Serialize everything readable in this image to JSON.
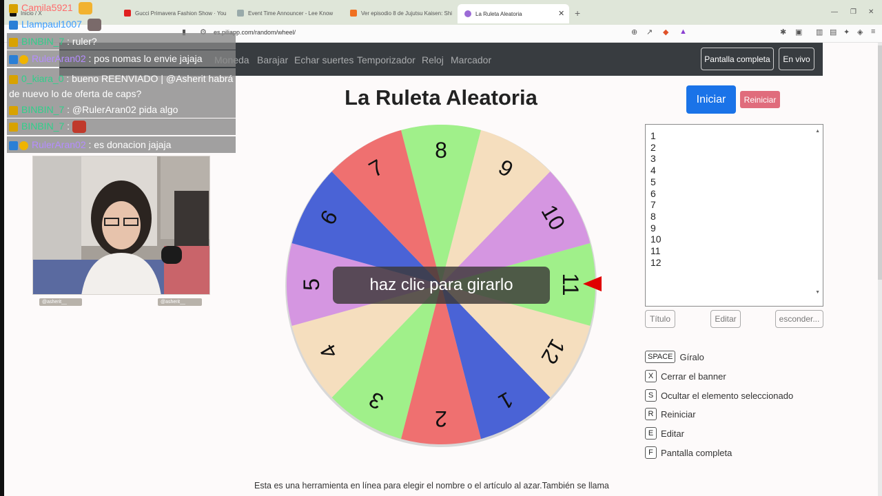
{
  "browser": {
    "tabs": [
      {
        "label": "Inicio / X"
      },
      {
        "label": "Gucci Primavera Fashion Show · You"
      },
      {
        "label": "Event Time Announcer - Lee Know"
      },
      {
        "label": "Ver episodio 8 de Jujutsu Kaisen: Shi"
      },
      {
        "label": "La Ruleta Aleatoria"
      }
    ],
    "url": "es.piliapp.com/random/wheel/"
  },
  "nav": {
    "items": [
      "Moneda",
      "Barajar",
      "Echar suertes",
      "Temporizador",
      "Reloj",
      "Marcador"
    ],
    "fullscreen": "Pantalla completa",
    "live": "En vivo"
  },
  "page": {
    "title": "La Ruleta Aleatoria",
    "start_button": "Iniciar",
    "reset_button": "Reiniciar",
    "spin_overlay": "haz clic para girarlo",
    "list_items": [
      "1",
      "2",
      "3",
      "4",
      "5",
      "6",
      "7",
      "8",
      "9",
      "10",
      "11",
      "12"
    ],
    "title_button": "Título",
    "edit_button": "Editar",
    "hide_button": "esconder...",
    "shortcuts": [
      {
        "key": "SPACE",
        "label": "Gíralo"
      },
      {
        "key": "X",
        "label": "Cerrar el banner"
      },
      {
        "key": "S",
        "label": "Ocultar el elemento seleccionado"
      },
      {
        "key": "R",
        "label": "Reiniciar"
      },
      {
        "key": "E",
        "label": "Editar"
      },
      {
        "key": "F",
        "label": "Pantalla completa"
      }
    ],
    "footer": "Esta es una herramienta en línea para elegir el nombre o el artículo al azar.También se llama"
  },
  "wheel": {
    "segments": [
      {
        "label": "8",
        "color": "#a0f08a"
      },
      {
        "label": "9",
        "color": "#f5debe"
      },
      {
        "label": "10",
        "color": "#d596e1"
      },
      {
        "label": "11",
        "color": "#a0f08a"
      },
      {
        "label": "12",
        "color": "#f5debe"
      },
      {
        "label": "1",
        "color": "#4a63d6"
      },
      {
        "label": "2",
        "color": "#ef7070"
      },
      {
        "label": "3",
        "color": "#a0f08a"
      },
      {
        "label": "4",
        "color": "#f5debe"
      },
      {
        "label": "5",
        "color": "#d596e1"
      },
      {
        "label": "6",
        "color": "#4a63d6"
      },
      {
        "label": "7",
        "color": "#ef7070"
      }
    ],
    "pointer_color": "#e00000"
  },
  "chat": [
    {
      "name": "Camila5921",
      "name_color": "#ff6b6b",
      "text": "",
      "badges": [
        "crown"
      ]
    },
    {
      "name": "Llampaul1007",
      "name_color": "#3a9cff",
      "text": "",
      "badges": [
        "prime"
      ]
    },
    {
      "name": "BINBIN_7",
      "name_color": "#2fd08a",
      "text": ": ruler?",
      "badges": [
        "crown"
      ]
    },
    {
      "name": "RulerAran02",
      "name_color": "#b58cff",
      "text": ": pos nomas lo envie jajaja",
      "badges": [
        "prime",
        "warn"
      ]
    },
    {
      "name": "0_kiara_0",
      "name_color": "#2fd08a",
      "text": ": bueno REENVIADO | @Asherit habrá de nuevo lo de oferta de caps?",
      "badges": [
        "crown"
      ]
    },
    {
      "name": "BINBIN_7",
      "name_color": "#2fd08a",
      "text": ": @RulerAran02 pida algo",
      "badges": [
        "crown"
      ]
    },
    {
      "name": "BINBIN_7",
      "name_color": "#2fd08a",
      "text": ":",
      "badges": [
        "crown"
      ]
    },
    {
      "name": "RulerAran02",
      "name_color": "#b58cff",
      "text": ": es donacion jajaja",
      "badges": [
        "prime",
        "warn"
      ]
    }
  ],
  "webcam": {
    "captions": [
      "@asherit__",
      "@asherit__"
    ]
  }
}
